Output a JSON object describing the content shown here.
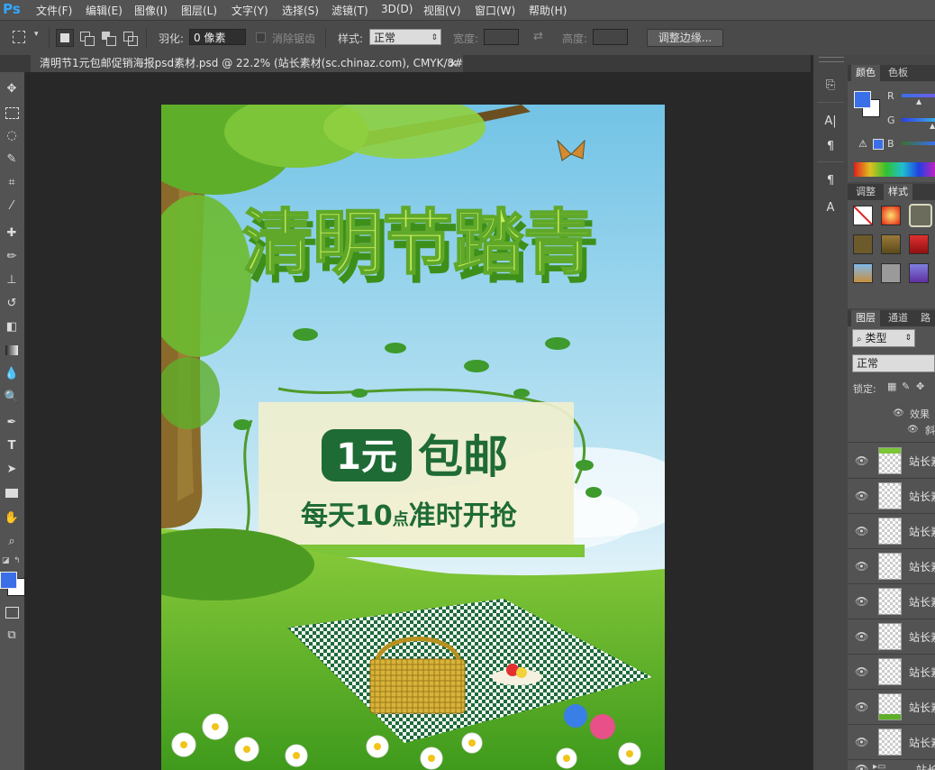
{
  "app": {
    "logo": "Ps",
    "accent": "#31a8ff"
  },
  "menu": [
    "文件(F)",
    "编辑(E)",
    "图像(I)",
    "图层(L)",
    "文字(Y)",
    "选择(S)",
    "滤镜(T)",
    "3D(D)",
    "视图(V)",
    "窗口(W)",
    "帮助(H)"
  ],
  "options": {
    "feather_label": "羽化:",
    "feather_value": "0 像素",
    "antialias_label": "消除锯齿",
    "style_label": "样式:",
    "style_value": "正常",
    "width_label": "宽度:",
    "height_label": "高度:",
    "refine_edge": "调整边缘..."
  },
  "document": {
    "tab_title": "清明节1元包邮促销海报psd素材.psd @ 22.2% (站长素材(sc.chinaz.com), CMYK/8#)",
    "close_glyph": "×"
  },
  "poster": {
    "headline": "清明节踏青",
    "promo_badge": "1元",
    "promo_text": "包邮",
    "promo_sub_a": "每天10",
    "promo_sub_b": "点",
    "promo_sub_c": "准时开抢"
  },
  "color_panel": {
    "tabs": [
      "颜色",
      "色板"
    ],
    "channels": [
      "R",
      "G",
      "B"
    ],
    "foreground": "#3b6fe8",
    "background": "#ffffff"
  },
  "styles_panel": {
    "tabs": [
      "调整",
      "样式"
    ]
  },
  "layers_panel": {
    "tabs": [
      "图层",
      "通道",
      "路"
    ],
    "filter_label": "类型",
    "blend_mode": "正常",
    "lock_label": "锁定:",
    "effects_label": "效果",
    "effect_item": "斜",
    "layers": [
      "站长素",
      "站长素",
      "站长素",
      "站长素",
      "站长素",
      "站长素",
      "站长素",
      "站长素",
      "站长素"
    ],
    "group_label": "站长"
  }
}
